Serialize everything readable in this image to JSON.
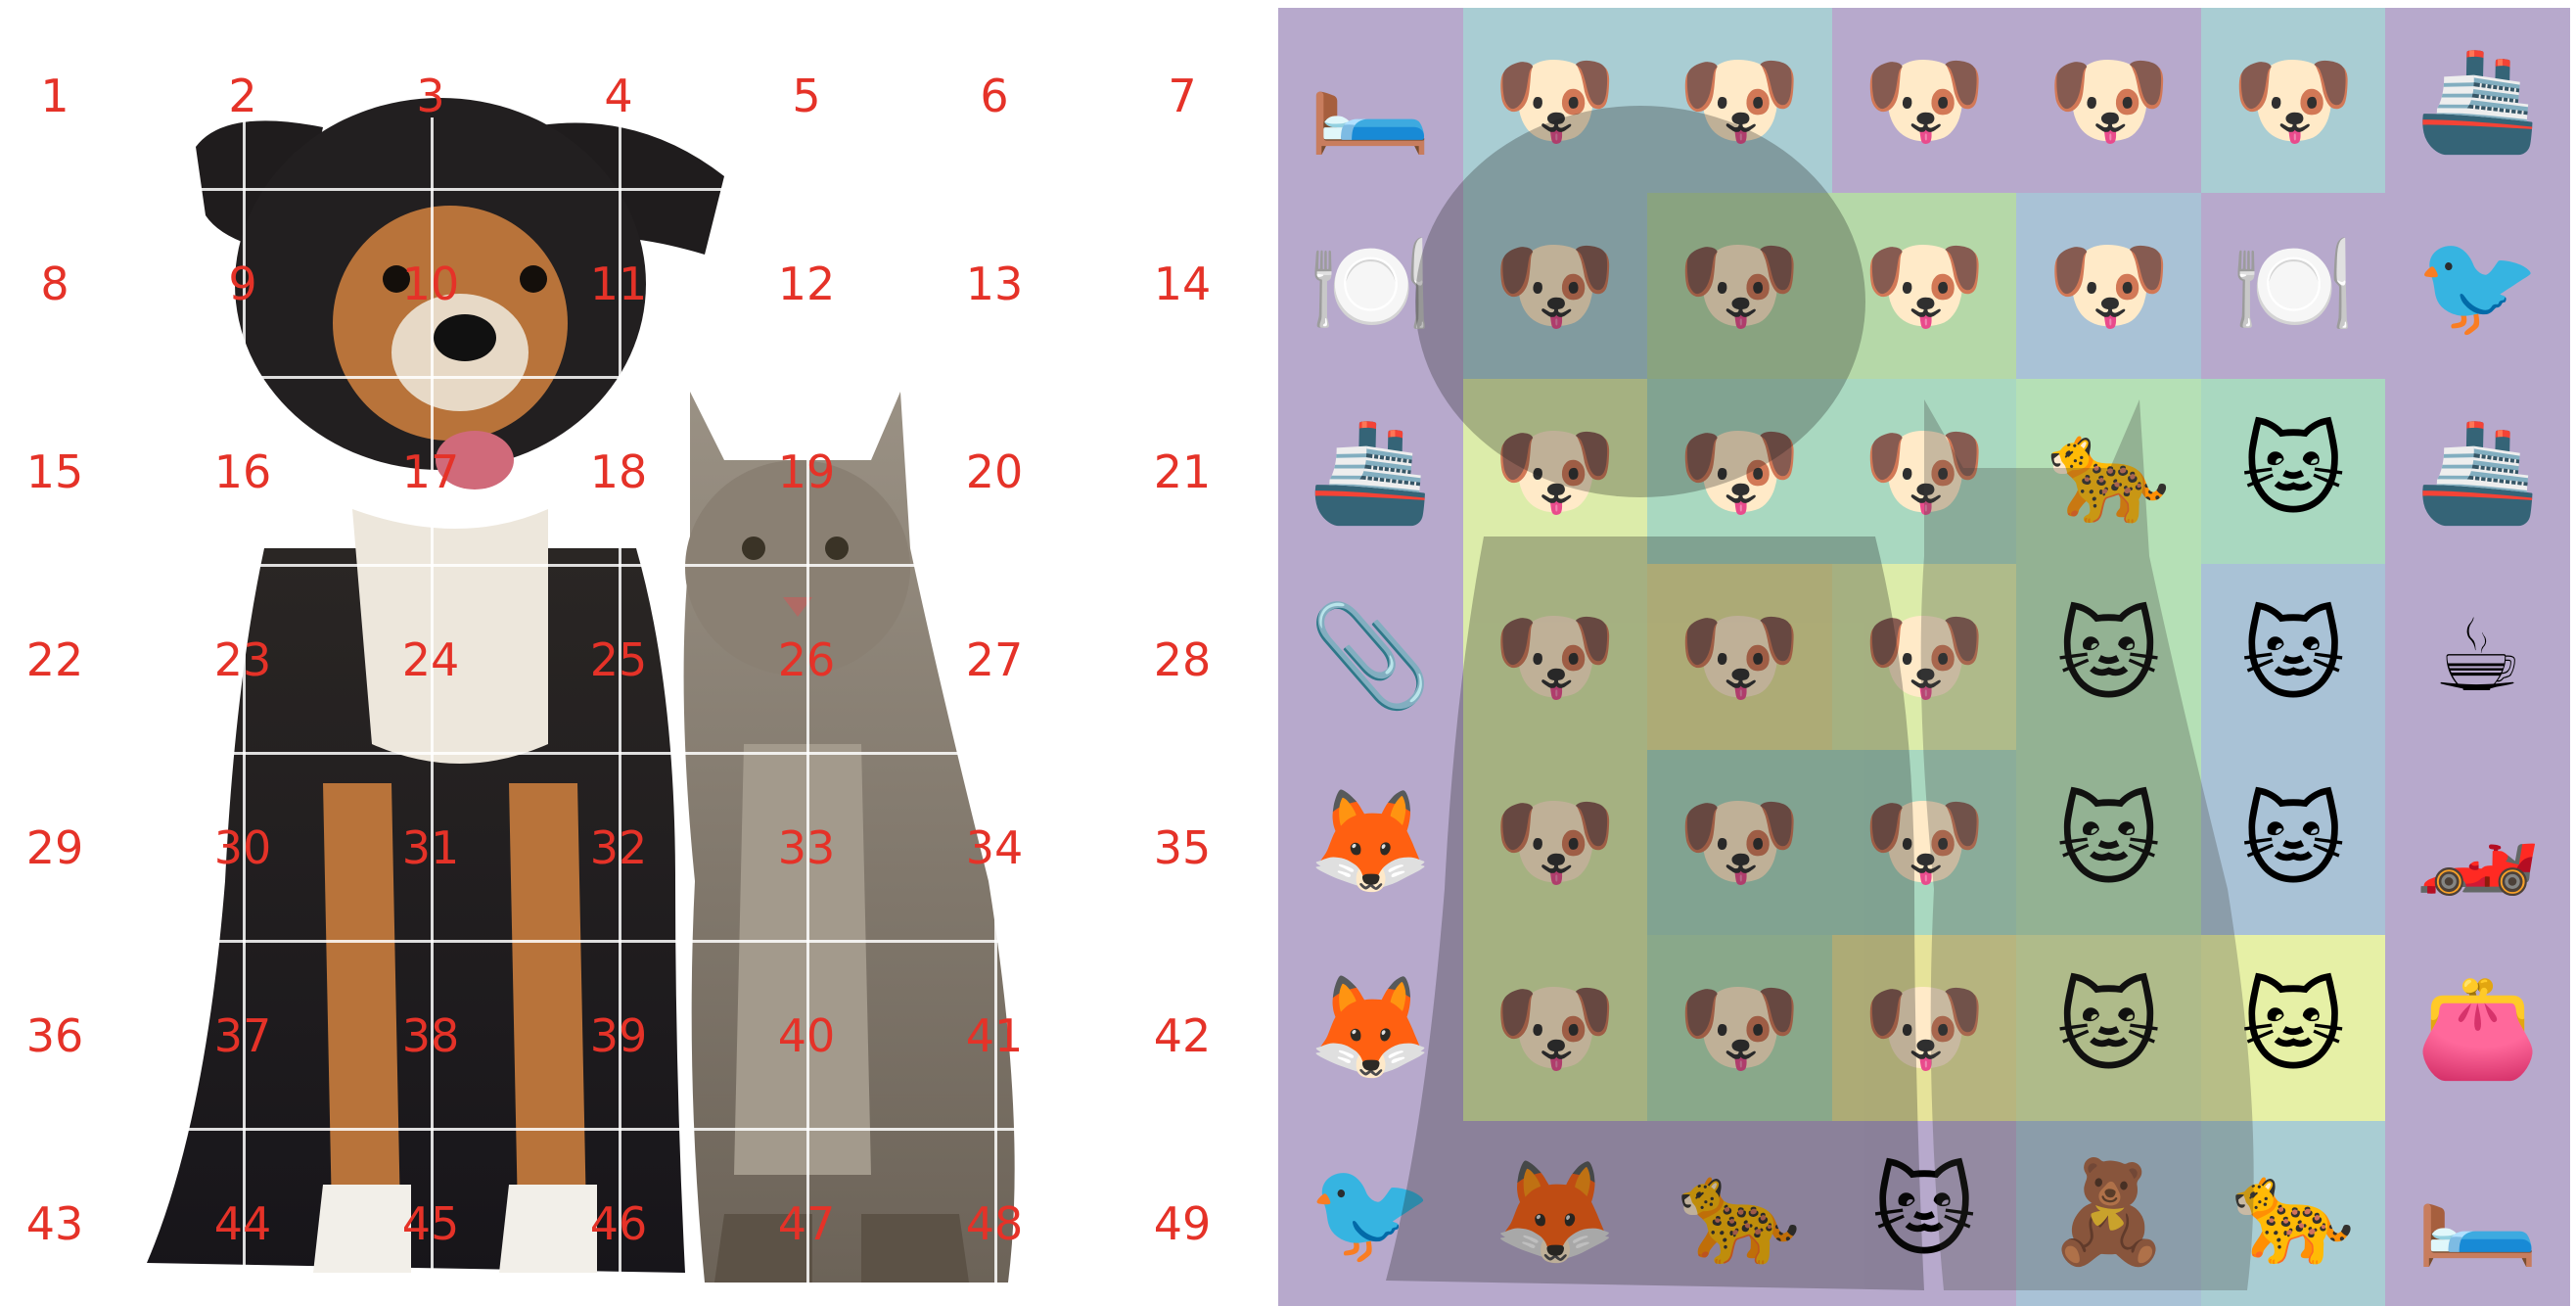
{
  "left_grid": {
    "rows": 7,
    "cols": 7,
    "labels": [
      "1",
      "2",
      "3",
      "4",
      "5",
      "6",
      "7",
      "8",
      "9",
      "10",
      "11",
      "12",
      "13",
      "14",
      "15",
      "16",
      "17",
      "18",
      "19",
      "20",
      "21",
      "22",
      "23",
      "24",
      "25",
      "26",
      "27",
      "28",
      "29",
      "30",
      "31",
      "32",
      "33",
      "34",
      "35",
      "36",
      "37",
      "38",
      "39",
      "40",
      "41",
      "42",
      "43",
      "44",
      "45",
      "46",
      "47",
      "48",
      "49"
    ],
    "label_color": "#e53228"
  },
  "right_grid": {
    "rows": 7,
    "cols": 7,
    "tiles": [
      {
        "icon": "bed-icon",
        "glyph": "🛏️",
        "tint": "#b7a9cc"
      },
      {
        "icon": "dog-face-icon",
        "glyph": "🐶",
        "tint": "#a9cdd3"
      },
      {
        "icon": "dog-face-icon",
        "glyph": "🐶",
        "tint": "#a9cdd3"
      },
      {
        "icon": "dog-face-icon",
        "glyph": "🐶",
        "tint": "#b7a9cc"
      },
      {
        "icon": "dog-face-icon",
        "glyph": "🐶",
        "tint": "#b7a9cc"
      },
      {
        "icon": "dog-face-icon",
        "glyph": "🐶",
        "tint": "#a9cdd3"
      },
      {
        "icon": "ship-icon",
        "glyph": "🚢",
        "tint": "#b7a9cc"
      },
      {
        "icon": "fork-knife-plate-icon",
        "glyph": "🍽️",
        "tint": "#b7a9cc"
      },
      {
        "icon": "dog-face-icon",
        "glyph": "🐶",
        "tint": "#a9cdd3"
      },
      {
        "icon": "dog-face-icon",
        "glyph": "🐶",
        "tint": "#b5d8a8"
      },
      {
        "icon": "dog-face-icon",
        "glyph": "🐶",
        "tint": "#b5d8a8"
      },
      {
        "icon": "dog-face-icon",
        "glyph": "🐶",
        "tint": "#a9c2d6"
      },
      {
        "icon": "fork-knife-plate-icon",
        "glyph": "🍽️",
        "tint": "#b7a9cc"
      },
      {
        "icon": "bird-icon",
        "glyph": "🐦",
        "tint": "#b7a9cc"
      },
      {
        "icon": "ship-icon",
        "glyph": "🚢",
        "tint": "#b7a9cc"
      },
      {
        "icon": "dog-face-icon",
        "glyph": "🐶",
        "tint": "#dcecaa"
      },
      {
        "icon": "dog-face-icon",
        "glyph": "🐶",
        "tint": "#a9d8c0"
      },
      {
        "icon": "dog-face-icon",
        "glyph": "🐶",
        "tint": "#a9d8c0"
      },
      {
        "icon": "leopard-icon",
        "glyph": "🐆",
        "tint": "#b5e0b6"
      },
      {
        "icon": "cat-face-icon",
        "glyph": "🐱",
        "tint": "#a9d8c0"
      },
      {
        "icon": "ship-icon",
        "glyph": "🚢",
        "tint": "#b7a9cc"
      },
      {
        "icon": "paperclip-icon",
        "glyph": "📎",
        "tint": "#b7a9cc"
      },
      {
        "icon": "dog-face-icon",
        "glyph": "🐶",
        "tint": "#dcecaa"
      },
      {
        "icon": "dog-face-icon",
        "glyph": "🐶",
        "tint": "#e6e39a"
      },
      {
        "icon": "dog-face-icon",
        "glyph": "🐶",
        "tint": "#dcecaa"
      },
      {
        "icon": "cat-face-icon",
        "glyph": "🐱",
        "tint": "#b5e0b6"
      },
      {
        "icon": "cat-face-icon",
        "glyph": "🐱",
        "tint": "#a9c2d6"
      },
      {
        "icon": "hot-beverage-icon",
        "glyph": "☕",
        "tint": "#b7a9cc"
      },
      {
        "icon": "fox-face-icon",
        "glyph": "🦊",
        "tint": "#b7a9cc"
      },
      {
        "icon": "dog-face-icon",
        "glyph": "🐶",
        "tint": "#dcecaa"
      },
      {
        "icon": "dog-face-icon",
        "glyph": "🐶",
        "tint": "#a9d8c0"
      },
      {
        "icon": "dog-face-icon",
        "glyph": "🐶",
        "tint": "#a9d8c0"
      },
      {
        "icon": "cat-face-icon",
        "glyph": "🐱",
        "tint": "#b5e0b6"
      },
      {
        "icon": "cat-face-icon",
        "glyph": "🐱",
        "tint": "#a9c2d6"
      },
      {
        "icon": "racing-car-icon",
        "glyph": "🏎️",
        "tint": "#b7a9cc"
      },
      {
        "icon": "fox-face-icon",
        "glyph": "🦊",
        "tint": "#b7a9cc"
      },
      {
        "icon": "dog-face-icon",
        "glyph": "🐶",
        "tint": "#dcecaa"
      },
      {
        "icon": "dog-face-icon",
        "glyph": "🐶",
        "tint": "#b5e0b6"
      },
      {
        "icon": "dog-face-icon",
        "glyph": "🐶",
        "tint": "#e6e39a"
      },
      {
        "icon": "cat-face-icon",
        "glyph": "🐱",
        "tint": "#dcecaa"
      },
      {
        "icon": "cat-face-icon",
        "glyph": "🐱",
        "tint": "#e6f0a6"
      },
      {
        "icon": "purse-icon",
        "glyph": "👛",
        "tint": "#b7a9cc"
      },
      {
        "icon": "bird-icon",
        "glyph": "🐦",
        "tint": "#b7a9cc"
      },
      {
        "icon": "fox-face-icon",
        "glyph": "🦊",
        "tint": "#b7a9cc"
      },
      {
        "icon": "leopard-icon",
        "glyph": "🐆",
        "tint": "#b7a9cc"
      },
      {
        "icon": "cat-face-icon",
        "glyph": "🐱",
        "tint": "#b7a9cc"
      },
      {
        "icon": "teddy-bear-icon",
        "glyph": "🧸",
        "tint": "#a9c2d6"
      },
      {
        "icon": "leopard-icon",
        "glyph": "🐆",
        "tint": "#a9cdd3"
      },
      {
        "icon": "bed-icon",
        "glyph": "🛏️",
        "tint": "#b7a9cc"
      }
    ]
  },
  "colors": {
    "dog_black": "#1c1b1f",
    "dog_tan": "#b8733a",
    "dog_white": "#f1eee8",
    "cat_gray": "#8f8678",
    "cat_dark": "#4f473e"
  }
}
